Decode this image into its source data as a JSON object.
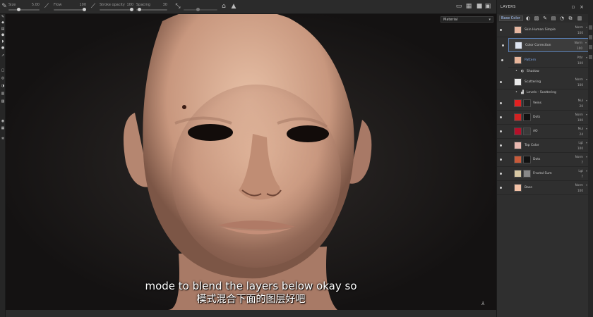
{
  "toolbar": {
    "size_label": "Size",
    "size_value": "5.00",
    "flow_label": "Flow",
    "flow_value": "100",
    "stroke_label": "Stroke opacity",
    "stroke_value": "100",
    "spacing_label": "Spacing",
    "spacing_value": "30"
  },
  "viewport": {
    "material_select": "Material"
  },
  "subtitles": {
    "english": "mode to blend the layers below okay so",
    "chinese": "模式混合下面的图层好吧"
  },
  "layers_panel": {
    "title": "LAYERS",
    "channel": "Base Color",
    "layers": [
      {
        "name": "Skin Human Simple",
        "blend": "Norm",
        "opacity": "100",
        "thumb": "#e5b6a0"
      },
      {
        "name": "Color Correction",
        "blend": "Norm",
        "opacity": "100",
        "thumb": "#dde4f0"
      },
      {
        "name": "Pattern",
        "blend": "Pthr",
        "opacity": "100",
        "thumb": "#e8b59a"
      },
      {
        "name": "Scattering",
        "blend": "Norm",
        "opacity": "100",
        "thumb": "#e9e9e9"
      },
      {
        "name": "Veins",
        "blend": "Mul",
        "opacity": "20",
        "thumb": "#e32121"
      },
      {
        "name": "Dots",
        "blend": "Norm",
        "opacity": "100",
        "thumb": "#d22222"
      },
      {
        "name": "AO",
        "blend": "Mul",
        "opacity": "24",
        "thumb": "#b5102a"
      },
      {
        "name": "Top Color",
        "blend": "Lgt",
        "opacity": "100",
        "thumb": "#e8b8b0"
      },
      {
        "name": "Dots",
        "blend": "Norm",
        "opacity": "7",
        "thumb": "#c85a3a"
      },
      {
        "name": "Fractal Sum",
        "blend": "Lgt",
        "opacity": "7",
        "thumb": "#d7c7a3"
      },
      {
        "name": "Base",
        "blend": "Norm",
        "opacity": "100",
        "thumb": "#f2c1a6"
      }
    ],
    "sub_shadow": "Shadow",
    "sub_levels": "Levels - Scattering"
  }
}
